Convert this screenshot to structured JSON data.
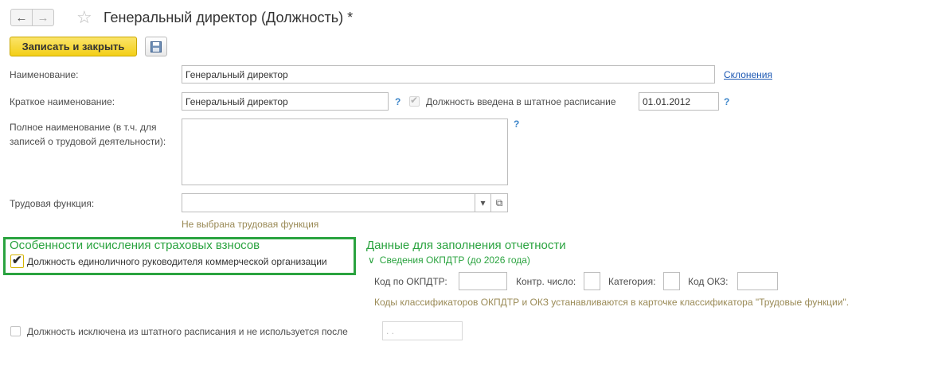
{
  "header": {
    "title": "Генеральный директор (Должность) *",
    "back_icon": "←",
    "forward_icon": "→",
    "star_icon": "☆"
  },
  "toolbar": {
    "save_close_label": "Записать и закрыть",
    "save_icon": "floppy-disk"
  },
  "form": {
    "name_label": "Наименование:",
    "name_value": "Генеральный директор",
    "declensions_link": "Склонения",
    "short_name_label": "Краткое наименование:",
    "short_name_value": "Генеральный директор",
    "help_mark": "?",
    "in_staff_label": "Должность введена в штатное расписание",
    "in_staff_date": "01.01.2012",
    "full_name_label_1": "Полное наименование (в т.ч. для",
    "full_name_label_2": "записей о трудовой деятельности):",
    "full_name_value": "",
    "labor_function_label": "Трудовая функция:",
    "labor_function_value": "",
    "labor_function_hint": "Не выбрана трудовая функция",
    "dropdown_icon": "▾",
    "open_icon": "⧉"
  },
  "insurance": {
    "heading": "Особенности исчисления страховых взносов",
    "sole_manager_label": "Должность единоличного руководителя коммерческой организации",
    "sole_manager_checked": true,
    "check_icon": "✔"
  },
  "reporting": {
    "heading": "Данные для заполнения отчетности",
    "okpdtr_section": "Сведения ОКПДТР (до 2026 года)",
    "chevron": "∨",
    "okpdtr_code_label": "Код по ОКПДТР:",
    "control_number_label": "Контр. число:",
    "category_label": "Категория:",
    "okz_code_label": "Код ОКЗ:",
    "hint": "Коды классификаторов ОКПДТР и ОКЗ устанавливаются в карточке классификатора \"Трудовые функции\"."
  },
  "excluded": {
    "label": "Должность исключена из штатного расписания и не используется после",
    "date_placeholder": " .  . "
  },
  "colors": {
    "accent_yellow": "#f3cf17",
    "green": "#2aa33f",
    "link_blue": "#1b57b3",
    "hint_brown": "#9a8a56"
  }
}
